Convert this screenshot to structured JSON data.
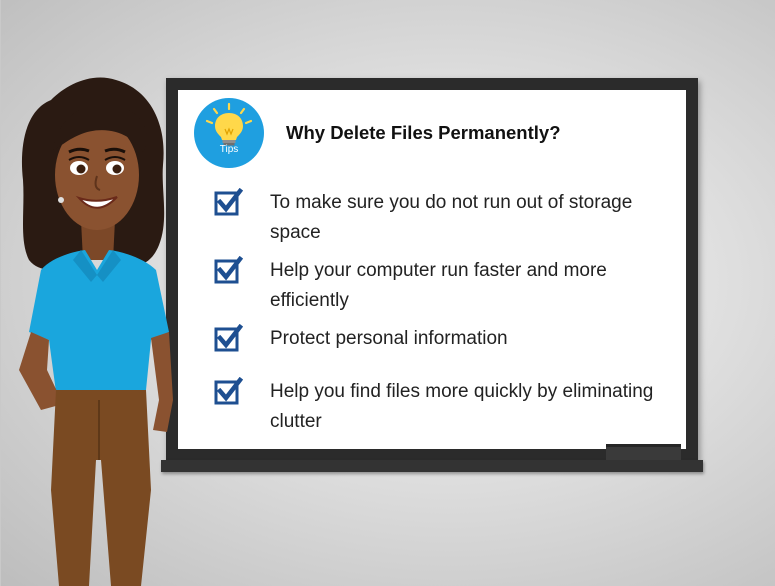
{
  "board": {
    "title": "Why Delete Files Permanently?",
    "tips_icon": {
      "name": "lightbulb-icon",
      "label": "Tips",
      "color": "#1f9fe0"
    },
    "checklist": [
      {
        "text": "To make sure you do not run out of storage space",
        "checked": true
      },
      {
        "text": "Help your computer run faster and more efficiently",
        "checked": true
      },
      {
        "text": "Protect personal information",
        "checked": true
      },
      {
        "text": "Help you find files more quickly by eliminating clutter",
        "checked": true
      }
    ],
    "check_color": "#1e4f91"
  },
  "colors": {
    "board_frame": "#2b2b2b",
    "background": "#d9d9d9",
    "shirt": "#1aa6dd",
    "pants": "#7a4a22",
    "skin": "#8a5230",
    "hair": "#2a1a12"
  }
}
